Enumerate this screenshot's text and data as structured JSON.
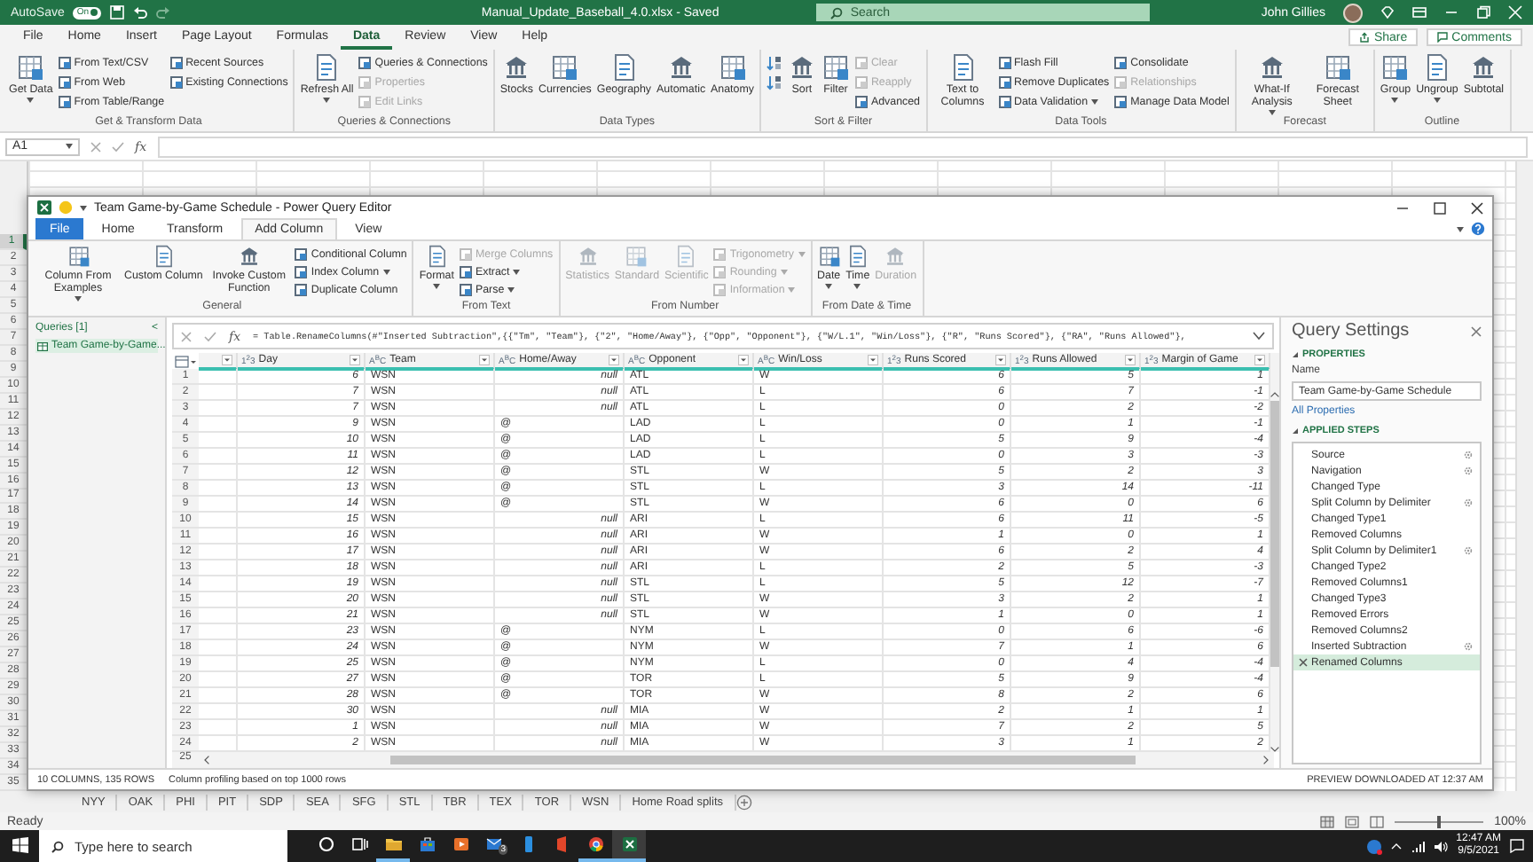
{
  "excel": {
    "title_bar": {
      "autosave_label": "AutoSave",
      "autosave": {
        "on": true,
        "label": "On"
      },
      "file_title": "Manual_Update_Baseball_4.0.xlsx - Saved",
      "search_placeholder": "Search",
      "user": "John Gillies"
    },
    "tabs": [
      {
        "label": "File",
        "selected": false
      },
      {
        "label": "Home",
        "selected": false
      },
      {
        "label": "Insert",
        "selected": false
      },
      {
        "label": "Page Layout",
        "selected": false
      },
      {
        "label": "Formulas",
        "selected": false
      },
      {
        "label": "Data",
        "selected": true
      },
      {
        "label": "Review",
        "selected": false
      },
      {
        "label": "View",
        "selected": false
      },
      {
        "label": "Help",
        "selected": false
      }
    ],
    "share": "Share",
    "comments": "Comments",
    "ribbon": [
      {
        "label": "Get & Transform Data",
        "items": [
          {
            "kind": "large",
            "label": "Get Data",
            "dropdown": true
          },
          {
            "kind": "small",
            "label": "From Text/CSV"
          },
          {
            "kind": "small",
            "label": "From Web"
          },
          {
            "kind": "small",
            "label": "From Table/Range"
          },
          {
            "kind": "small",
            "label": "Recent Sources"
          },
          {
            "kind": "small",
            "label": "Existing Connections"
          }
        ]
      },
      {
        "label": "Queries & Connections",
        "items": [
          {
            "kind": "large",
            "label": "Refresh All",
            "dropdown": true
          },
          {
            "kind": "small",
            "label": "Queries & Connections"
          },
          {
            "kind": "small",
            "label": "Properties",
            "disabled": true
          },
          {
            "kind": "small",
            "label": "Edit Links",
            "disabled": true
          }
        ]
      },
      {
        "label": "Data Types",
        "items": [
          {
            "kind": "large",
            "label": "Stocks"
          },
          {
            "kind": "large",
            "label": "Currencies"
          },
          {
            "kind": "large",
            "label": "Geography"
          },
          {
            "kind": "large",
            "label": "Automatic"
          },
          {
            "kind": "large",
            "label": "Anatomy"
          }
        ]
      },
      {
        "label": "Sort & Filter",
        "items": [
          {
            "kind": "icon"
          },
          {
            "kind": "icon"
          },
          {
            "kind": "large",
            "label": "Sort"
          },
          {
            "kind": "large",
            "label": "Filter"
          },
          {
            "kind": "small",
            "label": "Clear",
            "disabled": true
          },
          {
            "kind": "small",
            "label": "Reapply",
            "disabled": true
          },
          {
            "kind": "small",
            "label": "Advanced"
          }
        ]
      },
      {
        "label": "Data Tools",
        "items": [
          {
            "kind": "large",
            "label": "Text to Columns"
          },
          {
            "kind": "small",
            "label": "Flash Fill"
          },
          {
            "kind": "small",
            "label": "Remove Duplicates"
          },
          {
            "kind": "small",
            "label": "Data Validation",
            "dropdown": true
          },
          {
            "kind": "small",
            "label": "Consolidate"
          },
          {
            "kind": "small",
            "label": "Relationships",
            "disabled": true
          },
          {
            "kind": "small",
            "label": "Manage Data Model"
          }
        ]
      },
      {
        "label": "Forecast",
        "items": [
          {
            "kind": "large",
            "label": "What-If Analysis",
            "dropdown": true
          },
          {
            "kind": "large",
            "label": "Forecast Sheet"
          }
        ]
      },
      {
        "label": "Outline",
        "items": [
          {
            "kind": "large",
            "label": "Group",
            "dropdown": true
          },
          {
            "kind": "large",
            "label": "Ungroup",
            "dropdown": true
          },
          {
            "kind": "large",
            "label": "Subtotal"
          }
        ]
      }
    ],
    "formula_bar": {
      "name_box": "A1",
      "fx": "fx"
    },
    "row_numbers": [
      {
        "label": "1",
        "selected": true
      },
      {
        "label": "2",
        "selected": false
      },
      {
        "label": "3",
        "selected": false
      },
      {
        "label": "4",
        "selected": false
      },
      {
        "label": "5",
        "selected": false
      },
      {
        "label": "6",
        "selected": false
      },
      {
        "label": "7",
        "selected": false
      },
      {
        "label": "8",
        "selected": false
      },
      {
        "label": "9",
        "selected": false
      },
      {
        "label": "10",
        "selected": false
      },
      {
        "label": "11",
        "selected": false
      },
      {
        "label": "12",
        "selected": false
      },
      {
        "label": "13",
        "selected": false
      },
      {
        "label": "14",
        "selected": false
      },
      {
        "label": "15",
        "selected": false
      },
      {
        "label": "16",
        "selected": false
      },
      {
        "label": "17",
        "selected": false
      },
      {
        "label": "18",
        "selected": false
      },
      {
        "label": "19",
        "selected": false
      },
      {
        "label": "20",
        "selected": false
      },
      {
        "label": "21",
        "selected": false
      },
      {
        "label": "22",
        "selected": false
      },
      {
        "label": "23",
        "selected": false
      },
      {
        "label": "24",
        "selected": false
      },
      {
        "label": "25",
        "selected": false
      },
      {
        "label": "26",
        "selected": false
      },
      {
        "label": "27",
        "selected": false
      },
      {
        "label": "28",
        "selected": false
      },
      {
        "label": "29",
        "selected": false
      },
      {
        "label": "30",
        "selected": false
      },
      {
        "label": "31",
        "selected": false
      },
      {
        "label": "32",
        "selected": false
      },
      {
        "label": "33",
        "selected": false
      },
      {
        "label": "34",
        "selected": false
      },
      {
        "label": "35",
        "selected": false
      }
    ],
    "sheet_tabs": [
      "NYY",
      "OAK",
      "PHI",
      "PIT",
      "SDP",
      "SEA",
      "SFG",
      "STL",
      "TBR",
      "TEX",
      "TOR",
      "WSN",
      "Home Road splits"
    ],
    "status": "Ready",
    "zoom": {
      "level": 0.5,
      "reading": "100%"
    }
  },
  "power_query": {
    "title": "Team Game-by-Game Schedule - Power Query Editor",
    "tabs": [
      {
        "label": "File",
        "kind": "file",
        "selected": false
      },
      {
        "label": "Home",
        "kind": "tab",
        "selected": false
      },
      {
        "label": "Transform",
        "kind": "tab",
        "selected": false
      },
      {
        "label": "Add Column",
        "kind": "tab",
        "selected": true
      },
      {
        "label": "View",
        "kind": "tab",
        "selected": false
      }
    ],
    "ribbon": [
      {
        "label": "General",
        "items": [
          {
            "kind": "large",
            "label": "Column From Examples",
            "dropdown": true
          },
          {
            "kind": "large",
            "label": "Custom Column"
          },
          {
            "kind": "large",
            "label": "Invoke Custom Function"
          },
          {
            "kind": "small",
            "label": "Conditional Column"
          },
          {
            "kind": "small",
            "label": "Index Column",
            "dropdown": true
          },
          {
            "kind": "small",
            "label": "Duplicate Column"
          }
        ]
      },
      {
        "label": "From Text",
        "items": [
          {
            "kind": "large",
            "label": "Format",
            "dropdown": true
          },
          {
            "kind": "small",
            "label": "Merge Columns",
            "disabled": true
          },
          {
            "kind": "small",
            "label": "Extract",
            "dropdown": true
          },
          {
            "kind": "small",
            "label": "Parse",
            "dropdown": true
          }
        ]
      },
      {
        "label": "From Number",
        "items": [
          {
            "kind": "large",
            "label": "Statistics",
            "disabled": true
          },
          {
            "kind": "large",
            "label": "Standard",
            "disabled": true
          },
          {
            "kind": "large",
            "label": "Scientific",
            "disabled": true
          },
          {
            "kind": "small",
            "label": "Trigonometry",
            "dropdown": true,
            "disabled": true
          },
          {
            "kind": "small",
            "label": "Rounding",
            "dropdown": true,
            "disabled": true
          },
          {
            "kind": "small",
            "label": "Information",
            "dropdown": true,
            "disabled": true
          }
        ]
      },
      {
        "label": "From Date & Time",
        "items": [
          {
            "kind": "large",
            "label": "Date",
            "dropdown": true
          },
          {
            "kind": "large",
            "label": "Time",
            "dropdown": true
          },
          {
            "kind": "large",
            "label": "Duration",
            "disabled": true
          }
        ]
      }
    ],
    "queries": {
      "heading": "Queries [1]",
      "collapse": "<",
      "items": [
        {
          "label": "Team Game-by-Game...",
          "selected": true
        }
      ]
    },
    "formula": {
      "fx": "fx",
      "text": "= Table.RenameColumns(#\"Inserted Subtraction\",{{\"Tm\", \"Team\"}, {\"2\", \"Home/Away\"}, {\"Opp\", \"Opponent\"}, {\"W/L.1\", \"Win/Loss\"}, {\"R\", \"Runs Scored\"}, {\"RA\", \"Runs Allowed\"},"
    },
    "columns": [
      {
        "kind": "blank"
      },
      {
        "label": "Day",
        "kind": "number",
        "type_label": "1$^{2}$3"
      },
      {
        "label": "Team",
        "kind": "text",
        "type_label": "A$^{B}$C"
      },
      {
        "label": "Home/Away",
        "kind": "text",
        "type_label": "A$^{B}$C"
      },
      {
        "label": "Opponent",
        "kind": "text",
        "type_label": "A$^{B}$C"
      },
      {
        "label": "Win/Loss",
        "kind": "text",
        "type_label": "A$^{B}$C"
      },
      {
        "label": "Runs Scored",
        "kind": "number",
        "type_label": "1$^{2}$3"
      },
      {
        "label": "Runs Allowed",
        "kind": "number",
        "type_label": "1$^{2}$3"
      },
      {
        "label": "Margin of Game",
        "kind": "number",
        "type_label": "1$^{2}$3"
      }
    ],
    "rows": [
      {
        "number": "1",
        "cells": [
          "",
          "6",
          "WSN",
          {
            "text": "null",
            "is_null": true
          },
          "ATL",
          "W",
          "6",
          "5",
          "1"
        ]
      },
      {
        "number": "2",
        "cells": [
          "",
          "7",
          "WSN",
          {
            "text": "null",
            "is_null": true
          },
          "ATL",
          "L",
          "6",
          "7",
          "-1"
        ]
      },
      {
        "number": "3",
        "cells": [
          "",
          "7",
          "WSN",
          {
            "text": "null",
            "is_null": true
          },
          "ATL",
          "L",
          "0",
          "2",
          "-2"
        ]
      },
      {
        "number": "4",
        "cells": [
          "",
          "9",
          "WSN",
          "@",
          "LAD",
          "L",
          "0",
          "1",
          "-1"
        ]
      },
      {
        "number": "5",
        "cells": [
          "",
          "10",
          "WSN",
          "@",
          "LAD",
          "L",
          "5",
          "9",
          "-4"
        ]
      },
      {
        "number": "6",
        "cells": [
          "",
          "11",
          "WSN",
          "@",
          "LAD",
          "L",
          "0",
          "3",
          "-3"
        ]
      },
      {
        "number": "7",
        "cells": [
          "",
          "12",
          "WSN",
          "@",
          "STL",
          "W",
          "5",
          "2",
          "3"
        ]
      },
      {
        "number": "8",
        "cells": [
          "",
          "13",
          "WSN",
          "@",
          "STL",
          "L",
          "3",
          "14",
          "-11"
        ]
      },
      {
        "number": "9",
        "cells": [
          "",
          "14",
          "WSN",
          "@",
          "STL",
          "W",
          "6",
          "0",
          "6"
        ]
      },
      {
        "number": "10",
        "cells": [
          "",
          "15",
          "WSN",
          {
            "text": "null",
            "is_null": true
          },
          "ARI",
          "L",
          "6",
          "11",
          "-5"
        ]
      },
      {
        "number": "11",
        "cells": [
          "",
          "16",
          "WSN",
          {
            "text": "null",
            "is_null": true
          },
          "ARI",
          "W",
          "1",
          "0",
          "1"
        ]
      },
      {
        "number": "12",
        "cells": [
          "",
          "17",
          "WSN",
          {
            "text": "null",
            "is_null": true
          },
          "ARI",
          "W",
          "6",
          "2",
          "4"
        ]
      },
      {
        "number": "13",
        "cells": [
          "",
          "18",
          "WSN",
          {
            "text": "null",
            "is_null": true
          },
          "ARI",
          "L",
          "2",
          "5",
          "-3"
        ]
      },
      {
        "number": "14",
        "cells": [
          "",
          "19",
          "WSN",
          {
            "text": "null",
            "is_null": true
          },
          "STL",
          "L",
          "5",
          "12",
          "-7"
        ]
      },
      {
        "number": "15",
        "cells": [
          "",
          "20",
          "WSN",
          {
            "text": "null",
            "is_null": true
          },
          "STL",
          "W",
          "3",
          "2",
          "1"
        ]
      },
      {
        "number": "16",
        "cells": [
          "",
          "21",
          "WSN",
          {
            "text": "null",
            "is_null": true
          },
          "STL",
          "W",
          "1",
          "0",
          "1"
        ]
      },
      {
        "number": "17",
        "cells": [
          "",
          "23",
          "WSN",
          "@",
          "NYM",
          "L",
          "0",
          "6",
          "-6"
        ]
      },
      {
        "number": "18",
        "cells": [
          "",
          "24",
          "WSN",
          "@",
          "NYM",
          "W",
          "7",
          "1",
          "6"
        ]
      },
      {
        "number": "19",
        "cells": [
          "",
          "25",
          "WSN",
          "@",
          "NYM",
          "L",
          "0",
          "4",
          "-4"
        ]
      },
      {
        "number": "20",
        "cells": [
          "",
          "27",
          "WSN",
          "@",
          "TOR",
          "L",
          "5",
          "9",
          "-4"
        ]
      },
      {
        "number": "21",
        "cells": [
          "",
          "28",
          "WSN",
          "@",
          "TOR",
          "W",
          "8",
          "2",
          "6"
        ]
      },
      {
        "number": "22",
        "cells": [
          "",
          "30",
          "WSN",
          {
            "text": "null",
            "is_null": true
          },
          "MIA",
          "W",
          "2",
          "1",
          "1"
        ]
      },
      {
        "number": "23",
        "cells": [
          "",
          "1",
          "WSN",
          {
            "text": "null",
            "is_null": true
          },
          "MIA",
          "W",
          "7",
          "2",
          "5"
        ]
      },
      {
        "number": "24",
        "cells": [
          "",
          "2",
          "WSN",
          {
            "text": "null",
            "is_null": true
          },
          "MIA",
          "W",
          "3",
          "1",
          "2"
        ]
      }
    ],
    "scroll_row_number": "25",
    "settings": {
      "title": "Query Settings",
      "properties_heading": "PROPERTIES",
      "name_label": "Name",
      "name_value": "Team Game-by-Game Schedule",
      "all_properties": "All Properties",
      "steps_heading": "APPLIED STEPS",
      "steps": [
        {
          "label": "Source",
          "gear": true,
          "selected": false
        },
        {
          "label": "Navigation",
          "gear": true,
          "selected": false
        },
        {
          "label": "Changed Type",
          "gear": false,
          "selected": false
        },
        {
          "label": "Split Column by Delimiter",
          "gear": true,
          "selected": false
        },
        {
          "label": "Changed Type1",
          "gear": false,
          "selected": false
        },
        {
          "label": "Removed Columns",
          "gear": false,
          "selected": false
        },
        {
          "label": "Split Column by Delimiter1",
          "gear": true,
          "selected": false
        },
        {
          "label": "Changed Type2",
          "gear": false,
          "selected": false
        },
        {
          "label": "Removed Columns1",
          "gear": false,
          "selected": false
        },
        {
          "label": "Changed Type3",
          "gear": false,
          "selected": false
        },
        {
          "label": "Removed Errors",
          "gear": false,
          "selected": false
        },
        {
          "label": "Removed Columns2",
          "gear": false,
          "selected": false
        },
        {
          "label": "Inserted Subtraction",
          "gear": true,
          "selected": false
        },
        {
          "label": "Renamed Columns",
          "gear": false,
          "selected": true
        }
      ]
    },
    "status": {
      "summary": "10 COLUMNS, 135 ROWS",
      "profiling": "Column profiling based on top 1000 rows",
      "preview": "PREVIEW DOWNLOADED AT 12:37 AM"
    }
  },
  "taskbar": {
    "search_placeholder": "Type here to search",
    "apps": [
      {
        "kind": "cortana",
        "running": false,
        "active": false
      },
      {
        "kind": "task-view",
        "running": false,
        "active": false
      },
      {
        "kind": "folder",
        "running": true,
        "active": false
      },
      {
        "kind": "store",
        "running": false,
        "active": false
      },
      {
        "kind": "media",
        "running": false,
        "active": false
      },
      {
        "kind": "mail",
        "badge": "3",
        "running": false,
        "active": false
      },
      {
        "kind": "phone",
        "running": false,
        "active": false
      },
      {
        "kind": "office",
        "running": false,
        "active": false
      },
      {
        "kind": "browser",
        "running": true,
        "active": false
      },
      {
        "kind": "excel",
        "running": true,
        "active": true
      }
    ],
    "time": "12:47 AM",
    "date": "9/5/2021"
  }
}
